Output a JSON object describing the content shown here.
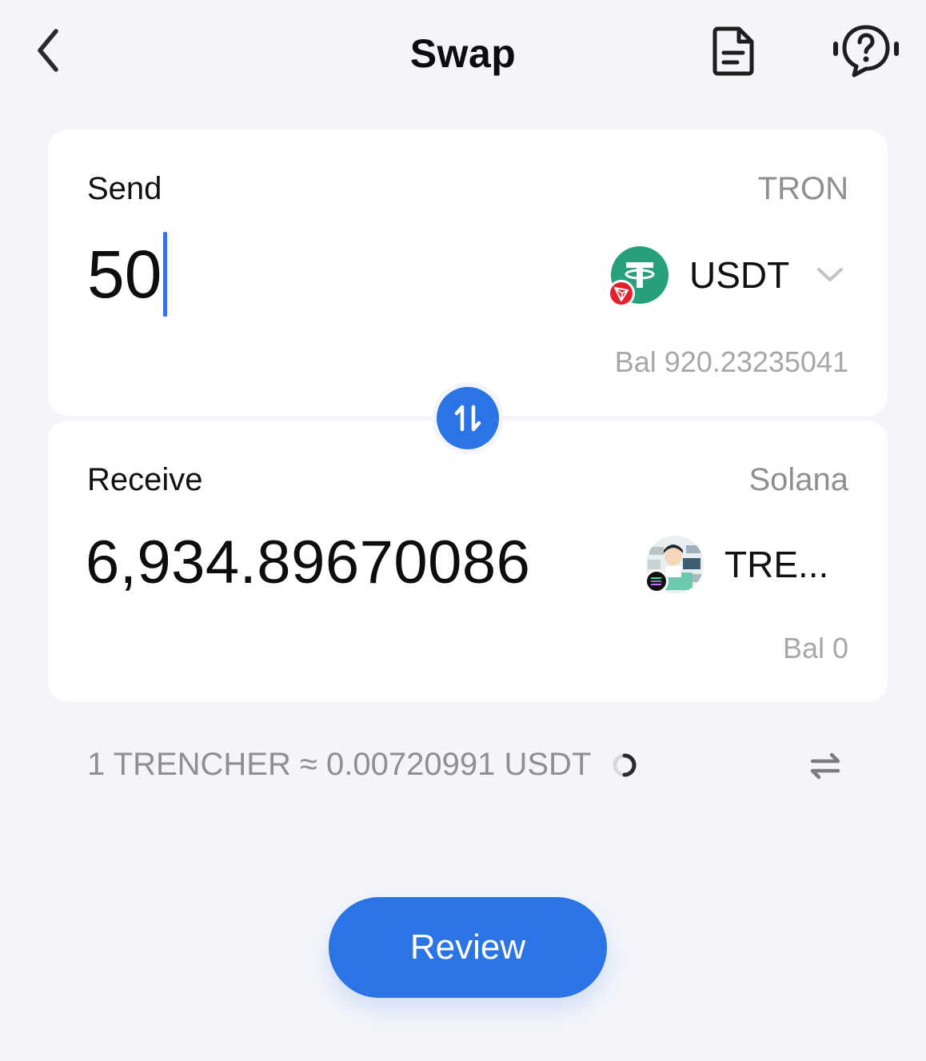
{
  "header": {
    "title": "Swap",
    "icons": [
      "back-chevron-icon",
      "document-icon",
      "help-chat-icon"
    ]
  },
  "send": {
    "label": "Send",
    "network": "TRON",
    "amount": "50",
    "token": "USDT",
    "token_icon": "tether-icon",
    "chain_badge_icon": "tron-icon",
    "balance": "Bal 920.23235041"
  },
  "receive": {
    "label": "Receive",
    "network": "Solana",
    "amount": "6,934.89670086",
    "token": "TRE...",
    "token_icon": "trencher-token-icon",
    "chain_badge_icon": "solana-icon",
    "balance": "Bal 0"
  },
  "rate": {
    "text": "1 TRENCHER ≈ 0.00720991 USDT"
  },
  "actions": {
    "review_label": "Review"
  },
  "colors": {
    "accent": "#2a74e5",
    "background": "#f4f5fa",
    "card": "#ffffff",
    "muted_text": "#8e8e93",
    "tether_green": "#26a17b",
    "tron_red": "#e5202b"
  }
}
